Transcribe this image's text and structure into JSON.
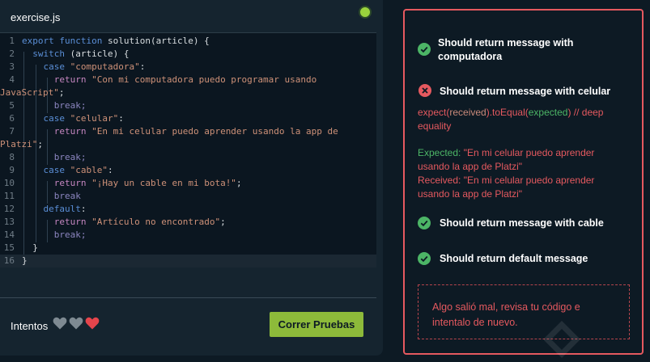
{
  "editor": {
    "file_name": "exercise.js",
    "status_color": "#9ad33d",
    "lines": [
      {
        "n": "1",
        "segments": [
          {
            "t": "export function",
            "c": "kw"
          },
          {
            "t": " solution(article) {",
            "c": ""
          }
        ]
      },
      {
        "n": "2",
        "segments": [
          {
            "t": "  ",
            "c": ""
          },
          {
            "t": "switch",
            "c": "kw"
          },
          {
            "t": " (article) {",
            "c": ""
          }
        ]
      },
      {
        "n": "3",
        "segments": [
          {
            "t": "    ",
            "c": ""
          },
          {
            "t": "case",
            "c": "kw"
          },
          {
            "t": " ",
            "c": ""
          },
          {
            "t": "\"computadora\"",
            "c": "str"
          },
          {
            "t": ":",
            "c": ""
          }
        ]
      },
      {
        "n": "4",
        "segments": [
          {
            "t": "      ",
            "c": ""
          },
          {
            "t": "return",
            "c": "ctrl"
          },
          {
            "t": " ",
            "c": ""
          },
          {
            "t": "\"Con mi computadora puedo programar usando",
            "c": "str"
          }
        ]
      },
      {
        "n": "",
        "segments": [
          {
            "t": "JavaScript\"",
            "c": "str"
          },
          {
            "t": ";",
            "c": ""
          }
        ]
      },
      {
        "n": "5",
        "segments": [
          {
            "t": "      ",
            "c": ""
          },
          {
            "t": "break",
            "c": "brk"
          },
          {
            "t": ";",
            "c": "brk"
          }
        ]
      },
      {
        "n": "6",
        "segments": [
          {
            "t": "    ",
            "c": ""
          },
          {
            "t": "case",
            "c": "kw"
          },
          {
            "t": " ",
            "c": ""
          },
          {
            "t": "\"celular\"",
            "c": "str"
          },
          {
            "t": ":",
            "c": ""
          }
        ]
      },
      {
        "n": "7",
        "segments": [
          {
            "t": "      ",
            "c": ""
          },
          {
            "t": "return",
            "c": "ctrl"
          },
          {
            "t": " ",
            "c": ""
          },
          {
            "t": "\"En mi celular puedo aprender usando la app de",
            "c": "str"
          }
        ]
      },
      {
        "n": "",
        "segments": [
          {
            "t": "Platzi\"",
            "c": "str"
          },
          {
            "t": ";",
            "c": ""
          }
        ]
      },
      {
        "n": "8",
        "segments": [
          {
            "t": "      ",
            "c": ""
          },
          {
            "t": "break",
            "c": "brk"
          },
          {
            "t": ";",
            "c": "brk"
          }
        ]
      },
      {
        "n": "9",
        "segments": [
          {
            "t": "    ",
            "c": ""
          },
          {
            "t": "case",
            "c": "kw"
          },
          {
            "t": " ",
            "c": ""
          },
          {
            "t": "\"cable\"",
            "c": "str"
          },
          {
            "t": ":",
            "c": ""
          }
        ]
      },
      {
        "n": "10",
        "segments": [
          {
            "t": "      ",
            "c": ""
          },
          {
            "t": "return",
            "c": "ctrl"
          },
          {
            "t": " ",
            "c": ""
          },
          {
            "t": "\"¡Hay un cable en mi bota!\"",
            "c": "str"
          },
          {
            "t": ";",
            "c": ""
          }
        ]
      },
      {
        "n": "11",
        "segments": [
          {
            "t": "      ",
            "c": ""
          },
          {
            "t": "break",
            "c": "brk"
          }
        ]
      },
      {
        "n": "12",
        "segments": [
          {
            "t": "    ",
            "c": ""
          },
          {
            "t": "default",
            "c": "kw"
          },
          {
            "t": ":",
            "c": ""
          }
        ]
      },
      {
        "n": "13",
        "segments": [
          {
            "t": "      ",
            "c": ""
          },
          {
            "t": "return",
            "c": "ctrl"
          },
          {
            "t": " ",
            "c": ""
          },
          {
            "t": "\"Artículo no encontrado\"",
            "c": "str"
          },
          {
            "t": ";",
            "c": ""
          }
        ]
      },
      {
        "n": "14",
        "segments": [
          {
            "t": "      ",
            "c": ""
          },
          {
            "t": "break",
            "c": "brk"
          },
          {
            "t": ";",
            "c": "brk"
          }
        ]
      },
      {
        "n": "15",
        "segments": [
          {
            "t": "  }",
            "c": ""
          }
        ]
      },
      {
        "n": "16",
        "segments": [
          {
            "t": "}",
            "c": ""
          }
        ]
      }
    ]
  },
  "footer": {
    "attempts_label": "Intentos",
    "hearts": [
      "grey",
      "grey",
      "red"
    ],
    "run_button_label": "Correr Pruebas"
  },
  "results": {
    "tests": [
      {
        "status": "pass",
        "title": "Should return message with computadora"
      },
      {
        "status": "fail",
        "title": "Should return message with celular"
      },
      {
        "status": "pass",
        "title": "Should return message with cable"
      },
      {
        "status": "pass",
        "title": "Should return default message"
      }
    ],
    "failure": {
      "expect_prefix": "expect(",
      "received_word": "received",
      "expect_mid": ").toEqual(",
      "expected_word": "expected",
      "expect_suffix": ") // deep",
      "expect_line2": "equality",
      "expected_label": "Expected:",
      "expected_value_1": "\"En mi celular puedo aprender",
      "expected_value_2": "usando la app de Platzi\"",
      "received_label": "Received:",
      "received_value_1": "\"En mi celular puedo aprender",
      "received_value_2": "usando la app de Platzi\""
    },
    "error_message": "Algo salió mal, revisa tu código e intentalo de nuevo."
  },
  "colors": {
    "pass": "#4cb566",
    "fail": "#e5595f",
    "accent_button": "#8dba3a"
  }
}
